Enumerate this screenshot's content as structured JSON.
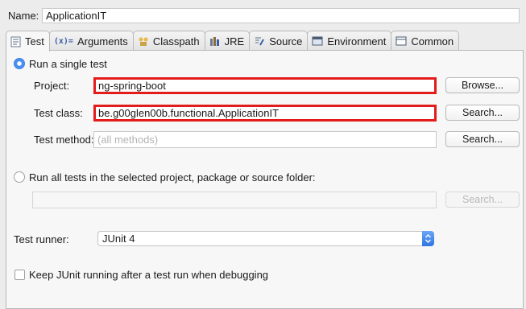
{
  "name": {
    "label": "Name:",
    "value": "ApplicationIT"
  },
  "tabs": [
    {
      "label": "Test",
      "icon": "test-icon"
    },
    {
      "label": "Arguments",
      "icon": "arguments-icon"
    },
    {
      "label": "Classpath",
      "icon": "classpath-icon"
    },
    {
      "label": "JRE",
      "icon": "jre-icon"
    },
    {
      "label": "Source",
      "icon": "source-icon"
    },
    {
      "label": "Environment",
      "icon": "environment-icon"
    },
    {
      "label": "Common",
      "icon": "common-icon"
    }
  ],
  "single_test": {
    "radio_label": "Run a single test",
    "selected": true,
    "project_label": "Project:",
    "project_value": "ng-spring-boot",
    "browse_label": "Browse...",
    "class_label": "Test class:",
    "class_value": "be.g00glen00b.functional.ApplicationIT",
    "search_label": "Search...",
    "method_label": "Test method:",
    "method_placeholder": "(all methods)"
  },
  "all_tests": {
    "radio_label": "Run all tests in the selected project, package or source folder:",
    "selected": false,
    "search_label": "Search..."
  },
  "runner": {
    "label": "Test runner:",
    "value": "JUnit 4"
  },
  "keep_running": {
    "label": "Keep JUnit running after a test run when debugging",
    "checked": false
  },
  "colors": {
    "highlight": "#e41b1b",
    "accent": "#3a82e6"
  }
}
